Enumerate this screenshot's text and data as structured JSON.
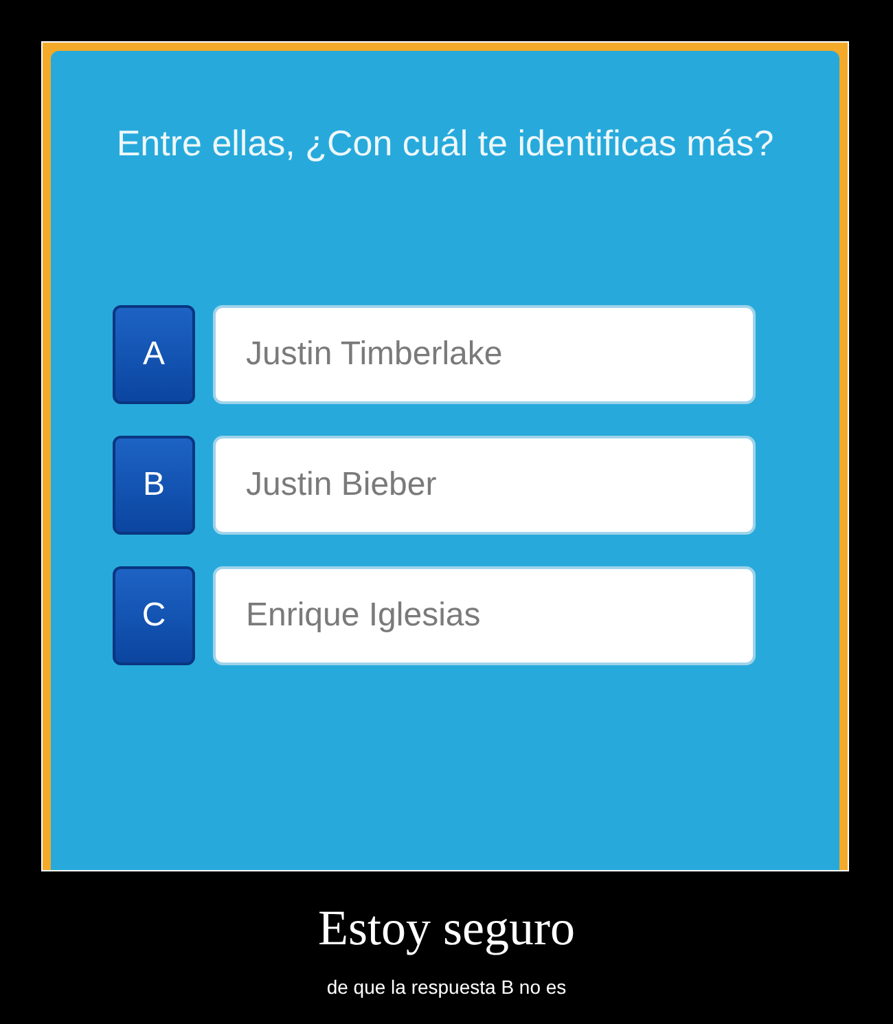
{
  "question": "Entre ellas, ¿Con cuál te identificas más?",
  "options": [
    {
      "letter": "A",
      "text": "Justin Timberlake"
    },
    {
      "letter": "B",
      "text": "Justin Bieber"
    },
    {
      "letter": "C",
      "text": "Enrique Iglesias"
    }
  ],
  "caption": {
    "title": "Estoy seguro",
    "subtitle": "de que la respuesta B no es"
  }
}
